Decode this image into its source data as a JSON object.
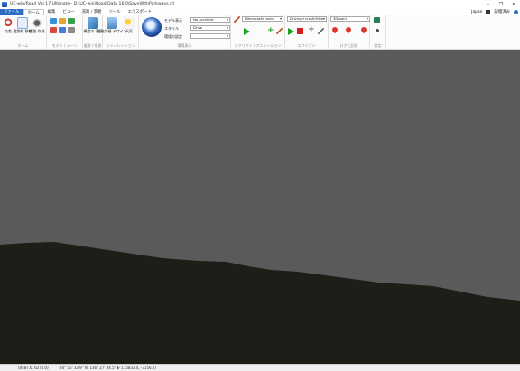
{
  "window": {
    "title": "UC-win/Road Ver.17 Ultimate - D:\\UC-win\\Road Data 16.0\\SaveWithParkways.rd",
    "minimize_glyph": "–",
    "maximize_glyph": "❐",
    "close_glyph": "✕"
  },
  "tabs": [
    "ファイル",
    "ホーム",
    "編集",
    "ビュー",
    "道路 / 景観",
    "ツール",
    "エクスポート"
  ],
  "active_tab_index": 1,
  "account": {
    "language": "Japan",
    "user": "記憶済み"
  },
  "ribbon": {
    "home_group": {
      "caption": "ホーム",
      "buttons": [
        "交差",
        "道路線 移動",
        "道路 作成"
      ]
    },
    "terrain_group": {
      "caption": "モデル / シーン"
    },
    "view_group": {
      "caption": "道路 / 地表",
      "button": "構造の 表示"
    },
    "sim_group": {
      "caption": "シミュレーション",
      "buttons": [
        "道路詳細 デザイン",
        "天気"
      ]
    },
    "environment_group": {
      "caption": "環境表示",
      "rows": [
        {
          "label": "モデル表示",
          "value": "No Accident"
        },
        {
          "label": "スタイル",
          "value": "Drive"
        },
        {
          "label": "環境の設定",
          "value": ""
        }
      ]
    },
    "scenario_group": {
      "caption": "スクリプト / アニメーション",
      "value": "Nihonbashi main"
    },
    "script_group": {
      "caption": "スクリプト",
      "value": "Driving+crashOther"
    },
    "datalog_group": {
      "caption": "ログと記録",
      "value": "3Dmat1"
    },
    "misc_group": {
      "caption": "設定"
    }
  },
  "colors": {
    "sky": "#5a5a5a",
    "ground": "#1c1e17",
    "file_tab": "#2b6cc4",
    "play_green": "#1ea21e",
    "stop_red": "#d22020"
  },
  "status": {
    "coords": "(8587.6, 6274.0)",
    "latlon": "34° 56' 33.9\" N, 136° 27' 34.5\" E",
    "elevation": "(- 115833.4, -3156.0)"
  }
}
